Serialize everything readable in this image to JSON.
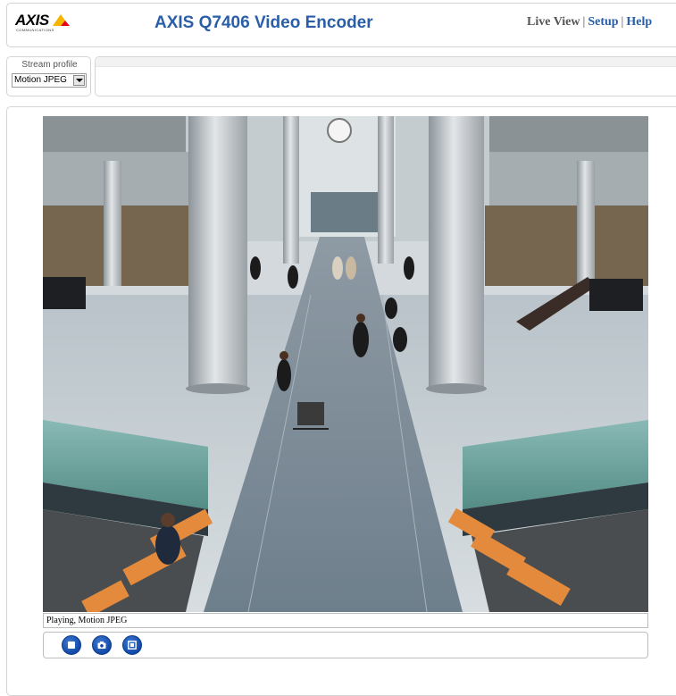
{
  "header": {
    "logo_text": "AXIS",
    "logo_sub": "COMMUNICATIONS",
    "product_title": "AXIS Q7406 Video Encoder",
    "nav": {
      "live_view": "Live View",
      "separator": "|",
      "setup": "Setup",
      "help": "Help"
    }
  },
  "stream_profile": {
    "label": "Stream profile",
    "selected": "Motion JPEG"
  },
  "video": {
    "status_text": "Playing, Motion JPEG"
  },
  "controls": {
    "icons": [
      "stop-icon",
      "snapshot-icon",
      "fullscreen-icon"
    ]
  },
  "colors": {
    "title_blue": "#2a5fa8",
    "button_blue": "#1249a6",
    "logo_yellow": "#f7b500",
    "logo_red": "#e2001a"
  }
}
